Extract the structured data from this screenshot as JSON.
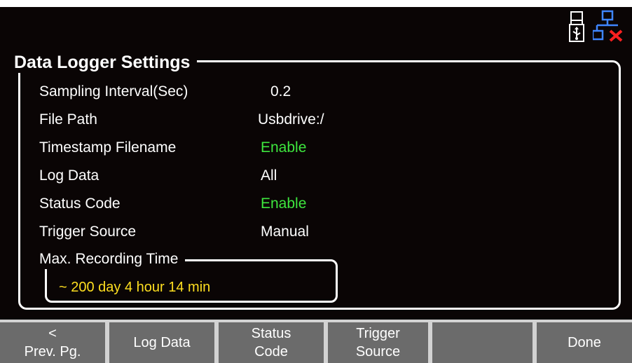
{
  "panel": {
    "title": "Data Logger Settings",
    "settings": [
      {
        "label": "Sampling Interval(Sec)",
        "value": "0.2",
        "color": "#ffffff"
      },
      {
        "label": "File Path",
        "value": "Usbdrive:/",
        "color": "#ffffff"
      },
      {
        "label": "Timestamp Filename",
        "value": "Enable",
        "color": "#3ee63e"
      },
      {
        "label": "Log Data",
        "value": "All",
        "color": "#ffffff"
      },
      {
        "label": "Status Code",
        "value": "Enable",
        "color": "#3ee63e"
      },
      {
        "label": "Trigger Source",
        "value": "Manual",
        "color": "#ffffff"
      }
    ],
    "max_recording": {
      "title": "Max. Recording Time",
      "value": "~ 200 day  4 hour  14 min"
    }
  },
  "status_icons": {
    "usb": "usb-icon",
    "network": "network-disconnected-icon"
  },
  "softkeys": {
    "prev_arrow": "<",
    "prev_label": "Prev. Pg.",
    "log_data": "Log Data",
    "status_code_l1": "Status",
    "status_code_l2": "Code",
    "trigger_source_l1": "Trigger",
    "trigger_source_l2": "Source",
    "blank": "",
    "done": "Done"
  },
  "colors": {
    "background": "#0a0505",
    "enabled_value": "#3ee63e",
    "recording_time": "#ffdf20",
    "softkey": "#6b6b6b"
  }
}
